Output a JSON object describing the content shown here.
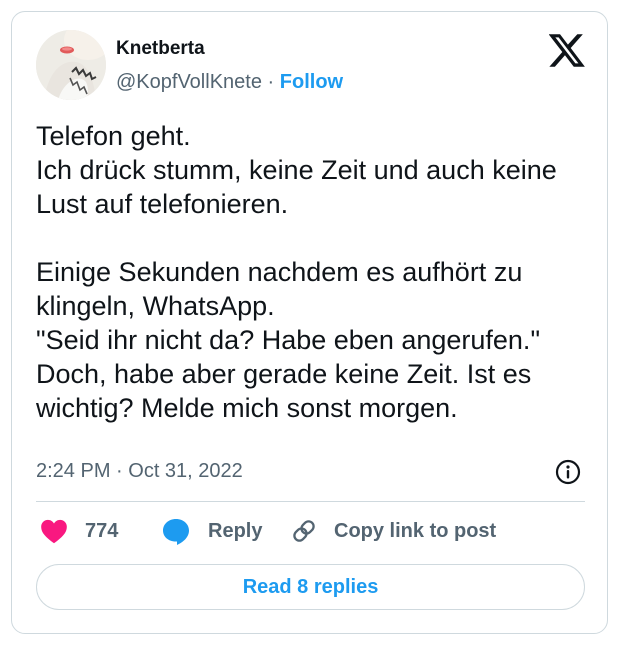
{
  "user": {
    "name": "Knetberta",
    "handle": "@KopfVollKnete",
    "separator": "·",
    "follow_label": "Follow"
  },
  "post": {
    "text": "Telefon geht.\nIch drück stumm, keine Zeit und auch keine Lust auf telefonieren.\n\nEinige Sekunden nachdem es aufhört zu klingeln, WhatsApp.\n\"Seid ihr nicht da? Habe eben angerufen.\"\nDoch, habe aber gerade keine Zeit. Ist es wichtig? Melde mich sonst morgen.",
    "timestamp": "2:24 PM · Oct 31, 2022"
  },
  "actions": {
    "like_count": "774",
    "reply_label": "Reply",
    "copy_link_label": "Copy link to post"
  },
  "footer": {
    "read_replies_label": "Read 8 replies"
  },
  "icons": {
    "brand": "x-logo-icon",
    "like": "heart-icon",
    "reply": "speech-bubble-icon",
    "copy_link": "link-icon",
    "info": "info-icon"
  },
  "colors": {
    "accent": "#1d9bf0",
    "like": "#f91880",
    "text": "#0f1419",
    "muted": "#536471",
    "border": "#cfd9de"
  }
}
